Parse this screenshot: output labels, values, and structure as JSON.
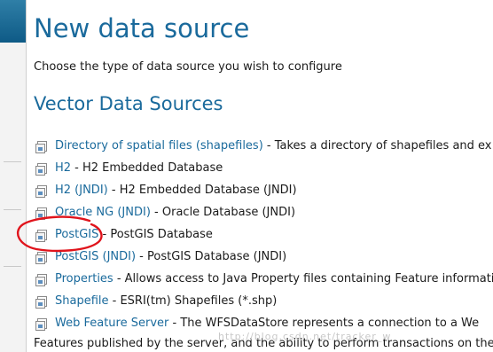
{
  "page": {
    "title": "New data source",
    "subtitle": "Choose the type of data source you wish to configure",
    "section_title": "Vector Data Sources"
  },
  "sources": [
    {
      "name": "Directory of spatial files (shapefiles)",
      "desc": " - Takes a directory of shapefiles and ex"
    },
    {
      "name": "H2",
      "desc": " - H2 Embedded Database"
    },
    {
      "name": "H2 (JNDI)",
      "desc": " - H2 Embedded Database (JNDI)"
    },
    {
      "name": "Oracle NG (JNDI)",
      "desc": " - Oracle Database (JNDI)"
    },
    {
      "name": "PostGIS",
      "desc": " - PostGIS Database"
    },
    {
      "name": "PostGIS (JNDI)",
      "desc": " - PostGIS Database (JNDI)"
    },
    {
      "name": "Properties",
      "desc": " - Allows access to Java Property files containing Feature informati"
    },
    {
      "name": "Shapefile",
      "desc": " - ESRI(tm) Shapefiles (*.shp)"
    },
    {
      "name": "Web Feature Server",
      "desc": " - The WFSDataStore represents a connection to a We"
    }
  ],
  "continuation": "Features published by the server, and the ability to perform transactions on the",
  "watermark": "http://blog.csdn.net/tracker_w",
  "colors": {
    "link": "#1a6a9c",
    "annotation": "#e0141c",
    "header_band": "#0e5a86"
  },
  "icons": {
    "datastore": "datastore-icon",
    "annotation": "hand-drawn-circle"
  }
}
